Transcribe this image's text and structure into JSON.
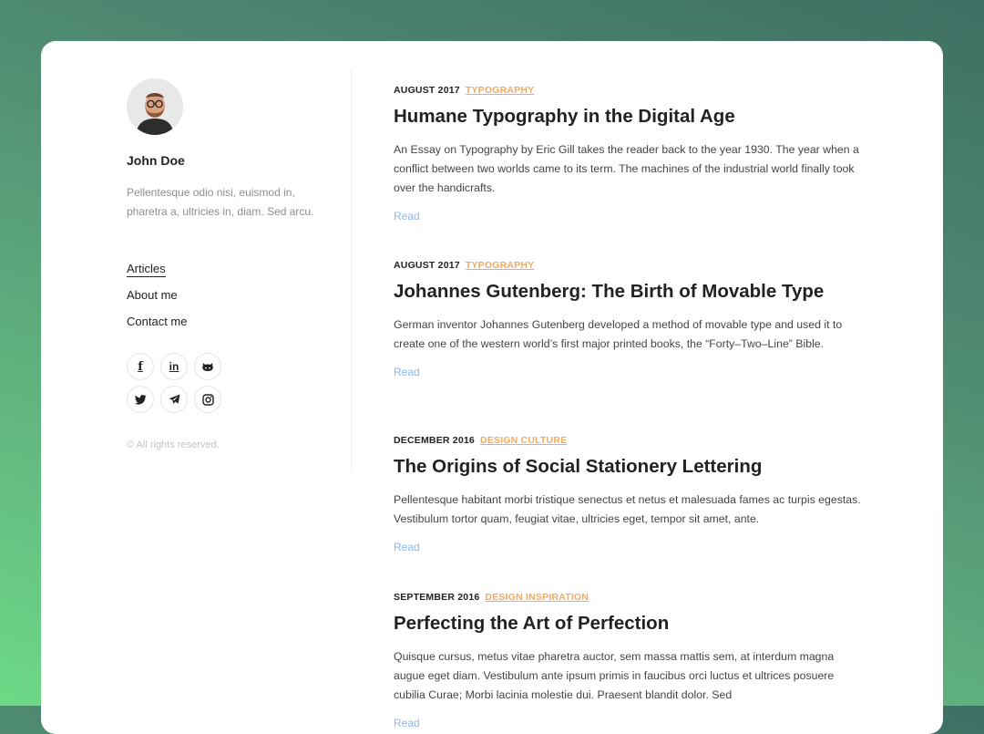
{
  "author": {
    "name": "John Doe",
    "bio": "Pellentesque odio nisi, euismod in, pharetra a, ultricies in, diam. Sed arcu."
  },
  "nav": {
    "items": [
      {
        "label": "Articles",
        "active": true
      },
      {
        "label": "About me",
        "active": false
      },
      {
        "label": "Contact me",
        "active": false
      }
    ]
  },
  "social": {
    "icons": [
      "facebook-icon",
      "linkedin-icon",
      "github-icon",
      "twitter-icon",
      "telegram-icon",
      "instagram-icon"
    ],
    "labels": {
      "facebook": "f",
      "linkedin": "in"
    }
  },
  "footer": {
    "copyright": "© All rights reserved."
  },
  "colors": {
    "accent_category": "#f2aa62",
    "link_read": "#8ab7ef",
    "text_main": "#222222",
    "text_muted": "#8f8f8f"
  },
  "posts": [
    {
      "date": "AUGUST 2017",
      "category": "TYPOGRAPHY",
      "title": "Humane Typography in the Digital Age",
      "excerpt": "An Essay on Typography by Eric Gill takes the reader back to the year 1930. The year when a conflict between two worlds came to its term. The machines of the industrial world finally took over the handicrafts.",
      "read_label": "Read"
    },
    {
      "date": "AUGUST 2017",
      "category": "TYPOGRAPHY",
      "title": "Johannes Gutenberg: The Birth of Movable Type",
      "excerpt": "German inventor Johannes Gutenberg developed a method of movable type and used it to create one of the western world’s first major printed books, the “Forty–Two–Line” Bible.",
      "read_label": "Read"
    },
    {
      "date": "DECEMBER 2016",
      "category": "DESIGN CULTURE",
      "title": "The Origins of Social Stationery Lettering",
      "excerpt": "Pellentesque habitant morbi tristique senectus et netus et malesuada fames ac turpis egestas. Vestibulum tortor quam, feugiat vitae, ultricies eget, tempor sit amet, ante.",
      "read_label": "Read"
    },
    {
      "date": "SEPTEMBER 2016",
      "category": "DESIGN INSPIRATION",
      "title": "Perfecting the Art of Perfection",
      "excerpt": "Quisque cursus, metus vitae pharetra auctor, sem massa mattis sem, at interdum magna augue eget diam. Vestibulum ante ipsum primis in faucibus orci luctus et ultrices posuere cubilia Curae; Morbi lacinia molestie dui. Praesent blandit dolor. Sed",
      "read_label": "Read"
    }
  ]
}
